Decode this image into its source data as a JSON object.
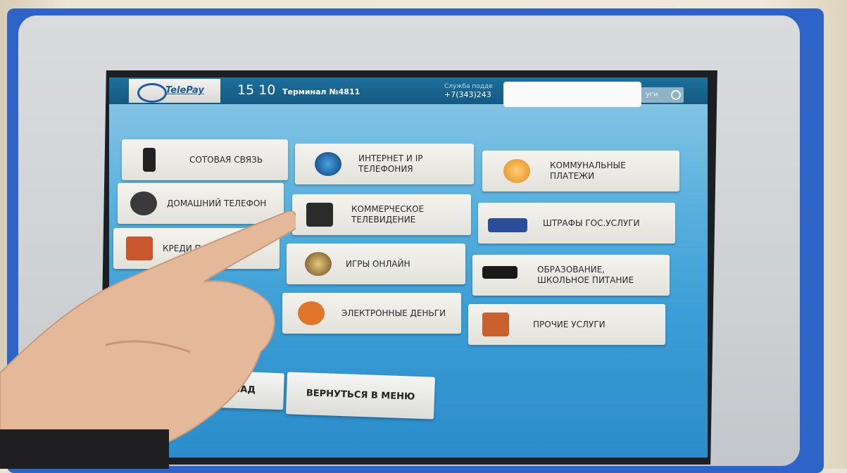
{
  "header": {
    "logo": "TelePay",
    "time": "15 10",
    "terminal": "Терминал №4811",
    "support_label": "Служба подде",
    "support_phone": "+7(343)243",
    "search_label": "уги"
  },
  "tiles": [
    {
      "label": "СОТОВАЯ СВЯЗЬ",
      "icon": "phone-icon"
    },
    {
      "label": "ИНТЕРНЕТ И IP ТЕЛЕФОНИЯ",
      "icon": "globe-icon"
    },
    {
      "label": "КОММУНАЛЬНЫЕ ПЛАТЕЖИ",
      "icon": "lightbulb-icon"
    },
    {
      "label": "ДОМАШНИЙ ТЕЛЕФОН",
      "icon": "landline-icon"
    },
    {
      "label": "КОММЕРЧЕСКОЕ ТЕЛЕВИДЕНИЕ",
      "icon": "tv-icon"
    },
    {
      "label": "ШТРАФЫ ГОС.УСЛУГИ",
      "icon": "police-car-icon"
    },
    {
      "label": "КРЕДИ П",
      "icon": "wallet-icon"
    },
    {
      "label": "ИГРЫ ОНЛАЙН",
      "icon": "roulette-icon"
    },
    {
      "label": "ОБРАЗОВАНИЕ, ШКОЛЬНОЕ ПИТАНИЕ",
      "icon": "graduation-cap-icon"
    },
    {
      "label": "ЭЛЕКТРОННЫЕ ДЕНЬГИ",
      "icon": "email-money-icon"
    },
    {
      "label": "ПРОЧИЕ УСЛУГИ",
      "icon": "box-icon"
    }
  ],
  "nav": {
    "back": "НАЗАД",
    "menu": "ВЕРНУТЬСЯ В МЕНЮ"
  },
  "colors": {
    "frame": "#2e63c7",
    "screen": "#3c9fd6",
    "topbar": "#145a82"
  }
}
